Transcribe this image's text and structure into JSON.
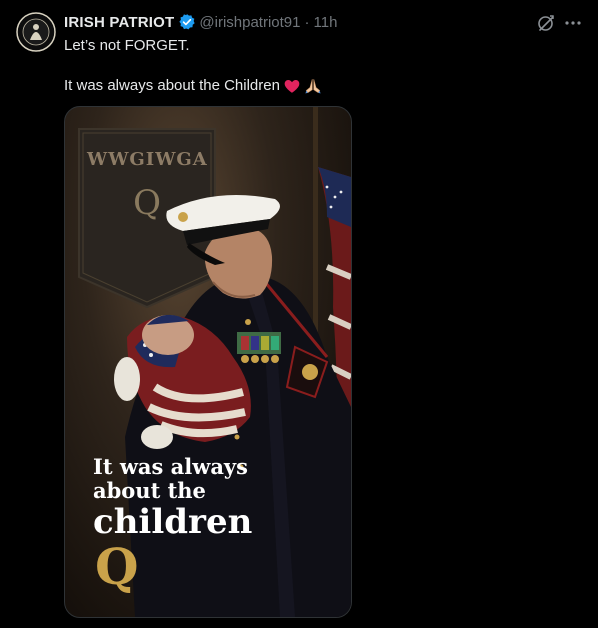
{
  "tweet": {
    "display_name": "IRISH PATRIOT",
    "handle": "@irishpatriot91",
    "separator": "·",
    "time": "11h",
    "line1": "Let’s not FORGET.",
    "line2": "It was always about the Children",
    "emojis": [
      "red-heart",
      "folded-hands"
    ]
  },
  "media": {
    "banner_text": "WWGIWGA",
    "banner_letter": "Q",
    "caption_line1": "It was always",
    "caption_line2": "about the",
    "caption_line3": "children",
    "logo_letter": "Q"
  },
  "colors": {
    "background": "#000000",
    "verified": "#1d9bf0",
    "secondary_text": "#71767b",
    "gold": "#c9a24a"
  },
  "icons": [
    "avatar",
    "verified-badge-icon",
    "grok-icon",
    "more-icon"
  ]
}
